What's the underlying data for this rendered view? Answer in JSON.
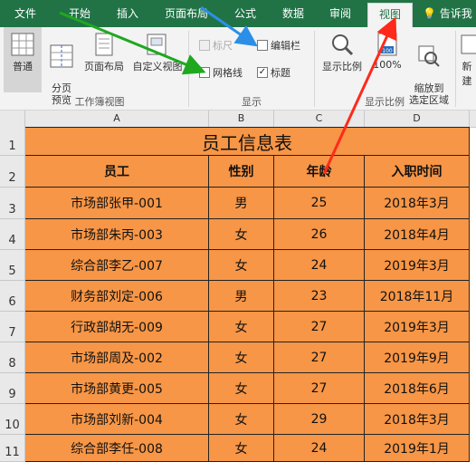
{
  "tabs": [
    "文件",
    "开始",
    "插入",
    "页面布局",
    "公式",
    "数据",
    "审阅",
    "视图"
  ],
  "active_tab": "视图",
  "tell_me": "告诉我",
  "ribbon": {
    "workbook_views": {
      "buttons": [
        "普通",
        "分页\n预览",
        "页面布局",
        "自定义视图"
      ],
      "group_label": "工作簿视图"
    },
    "show": {
      "ruler": {
        "label": "标尺",
        "checked": false,
        "disabled": true
      },
      "formula_bar": {
        "label": "编辑栏",
        "checked": false
      },
      "gridlines": {
        "label": "网格线",
        "checked": false
      },
      "headings": {
        "label": "标题",
        "checked": true
      },
      "group_label": "显示"
    },
    "zoom": {
      "zoom_button": "显示比例",
      "zoom100_button": "100%",
      "zoom_selection_button": "缩放到\n选定区域",
      "new_window_button": "新建",
      "group_label": "显示比例"
    }
  },
  "sheet": {
    "columns": [
      "A",
      "B",
      "C",
      "D"
    ],
    "rows": [
      "1",
      "2",
      "3",
      "4",
      "5",
      "6",
      "7",
      "8",
      "9",
      "10",
      "11"
    ],
    "title": "员工信息表",
    "headers": [
      "员工",
      "性别",
      "年龄",
      "入职时间"
    ],
    "data": [
      [
        "市场部张甲-001",
        "男",
        "25",
        "2018年3月"
      ],
      [
        "市场部朱丙-003",
        "女",
        "26",
        "2018年4月"
      ],
      [
        "综合部李乙-007",
        "女",
        "24",
        "2019年3月"
      ],
      [
        "财务部刘定-006",
        "男",
        "23",
        "2018年11月"
      ],
      [
        "行政部胡无-009",
        "女",
        "27",
        "2019年3月"
      ],
      [
        "市场部周及-002",
        "女",
        "27",
        "2019年9月"
      ],
      [
        "市场部黄更-005",
        "女",
        "27",
        "2018年6月"
      ],
      [
        "市场部刘新-004",
        "女",
        "29",
        "2018年3月"
      ],
      [
        "综合部李任-008",
        "女",
        "24",
        "2019年1月"
      ]
    ]
  },
  "annotation_colors": {
    "red": "#ff2a1a",
    "green": "#1fa81f",
    "blue": "#2b8fe8"
  },
  "cell_fill": "#f79646"
}
